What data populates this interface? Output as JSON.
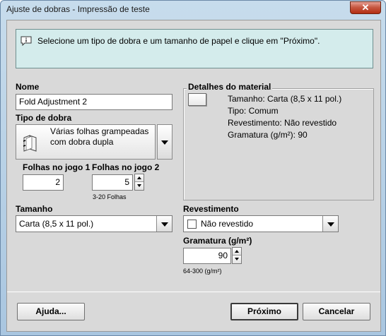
{
  "window": {
    "title": "Ajuste de dobras - Impressão de teste",
    "close_glyph": "✕"
  },
  "info": {
    "icon": "speech-info-icon",
    "message": "Selecione um tipo de dobra e um tamanho de papel e clique em \"Próximo\"."
  },
  "name": {
    "label": "Nome",
    "value": "Fold Adjustment 2"
  },
  "fold_type": {
    "label": "Tipo de dobra",
    "icon": "stapled-sheets-icon",
    "value": "Várias folhas grampeadas com dobra dupla"
  },
  "sheets_set1": {
    "label": "Folhas no jogo 1",
    "value": "2"
  },
  "sheets_set2": {
    "label": "Folhas no jogo 2",
    "value": "5",
    "hint": "3-20 Folhas"
  },
  "size": {
    "label": "Tamanho",
    "value": "Carta (8,5 x 11 pol.)"
  },
  "material": {
    "title": "Detalhes do material",
    "lines": [
      "Tamanho: Carta (8,5 x 11 pol.)",
      "Tipo: Comum",
      "Revestimento: Não revestido",
      "Gramatura (g/m²): 90"
    ]
  },
  "coating": {
    "label": "Revestimento",
    "value": "Não revestido"
  },
  "weight": {
    "label": "Gramatura (g/m²)",
    "value": "90",
    "hint": "64-300 (g/m²)"
  },
  "buttons": {
    "help": "Ajuda...",
    "next": "Próximo",
    "cancel": "Cancelar"
  }
}
